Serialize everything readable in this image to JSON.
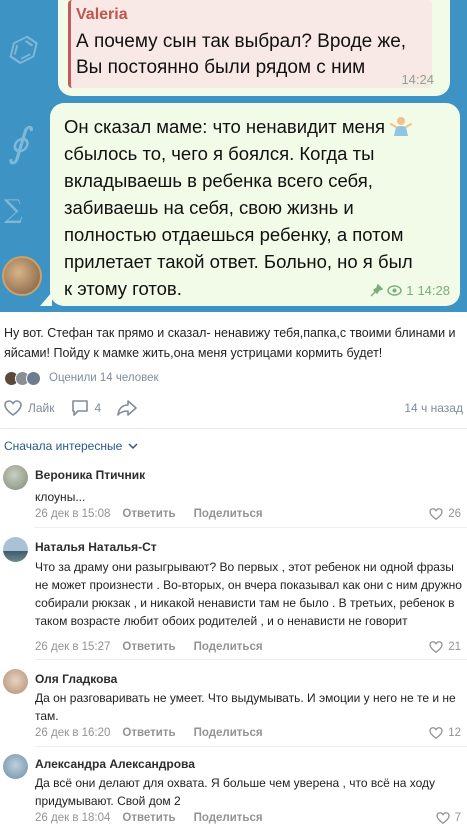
{
  "telegram": {
    "reply": {
      "author": "Valeria",
      "lines": [
        "А почему сын так выбрал? Вроде же,",
        "Вы постоянно были рядом с ним"
      ],
      "time": "14:24"
    },
    "message": {
      "lines": [
        "Он сказал маме: что ненавидит меня",
        "сбылось то, чего я боялся. Когда ты",
        "вкладываешь в ребенка всего себя,",
        "забиваешь на себя, свою жизнь и",
        "полностью отдаешься ребенку, а потом",
        "прилетает такой ответ. Больно, но я был",
        "к этому готов."
      ],
      "views": "1",
      "time": "14:28"
    }
  },
  "post": {
    "text": "Ну вот. Стефан так прямо и сказал- ненавижу тебя,папка,с твоими блинами и яйсами! Пойду к мамке жить,она меня устрицами кормить будет!",
    "reactions_text": "Оценили 14 человек",
    "like_label": "Лайк",
    "comments_count": "4",
    "time_ago": "14 ч назад"
  },
  "comments_sort": "Сначала интересные",
  "comments": [
    {
      "name": "Вероника Птичник",
      "text": "клоуны...",
      "date": "26 дек в 15:08",
      "reply": "Ответить",
      "share": "Поделиться",
      "likes": "26"
    },
    {
      "name": "Наталья Наталья-Ст",
      "text": "Что за драму они разыгрывают? Во первых , этот ребенок ни одной фразы не может произнести . Во-вторых, он вчера показывал как они с ним дружно собирали рюкзак , и никакой ненависти там не было . В третьих, ребенок в таком возрасте любит обоих родителей , и о ненависти не говорит",
      "date": "26 дек в 15:27",
      "reply": "Ответить",
      "share": "Поделиться",
      "likes": "21"
    },
    {
      "name": "Оля Гладкова",
      "text": "Да он разговаривать не умеет. Что выдумывать. И эмоции у него не те и не там.",
      "date": "26 дек в 16:20",
      "reply": "Ответить",
      "share": "Поделиться",
      "likes": "12"
    },
    {
      "name": "Александра Александрова",
      "text": "Да всё они делают для охвата. Я больше чем уверена , что всё на ходу придумывают. Свой дом 2",
      "date": "26 дек в 18:04",
      "reply": "Ответить",
      "share": "Поделиться",
      "likes": "7"
    }
  ],
  "colors": {
    "link": "#2a5885",
    "muted": "#818c99",
    "bubble": "#f1fbe7",
    "reply_accent": "#c2544d"
  }
}
